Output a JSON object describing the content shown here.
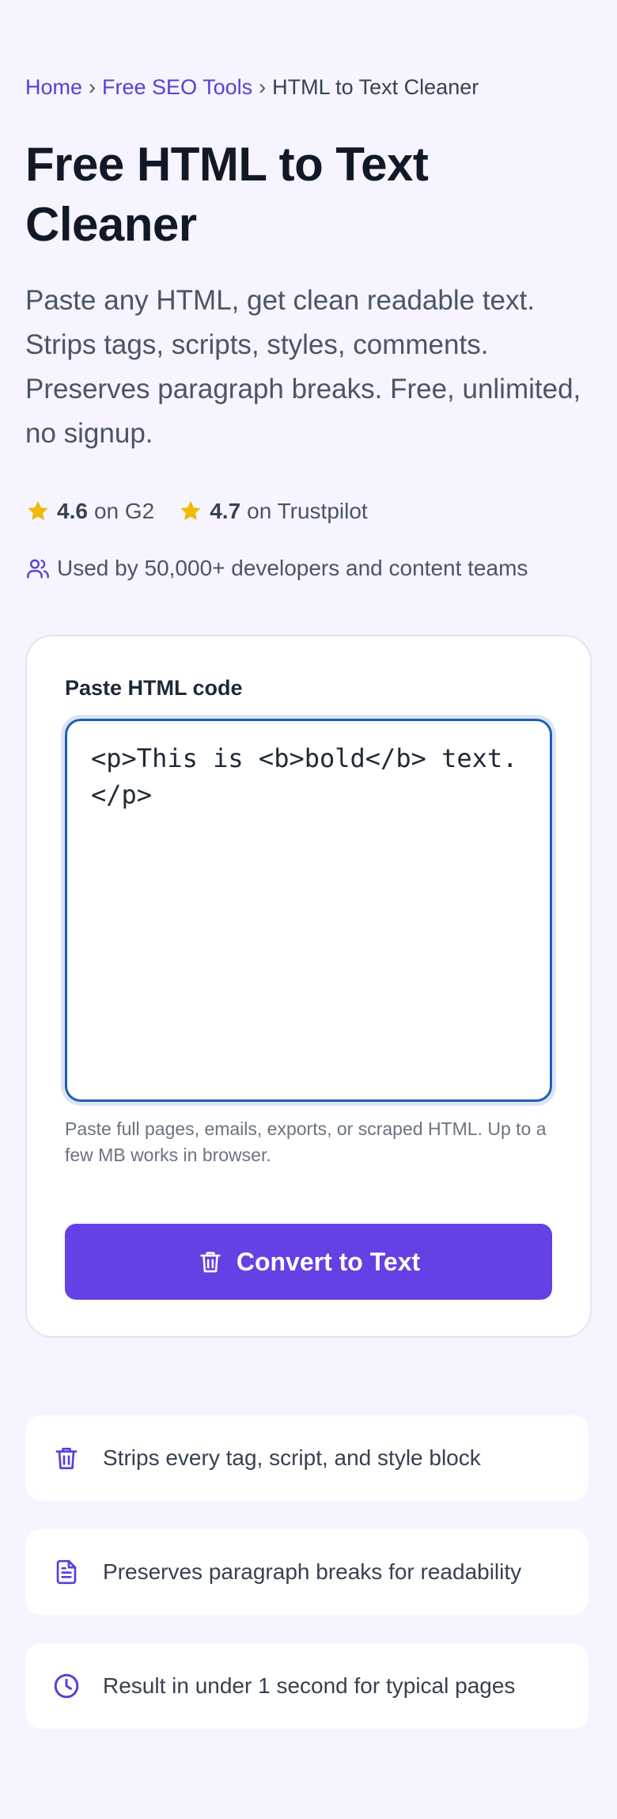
{
  "breadcrumb": {
    "items": [
      "Home",
      "Free SEO Tools"
    ],
    "separator": "›",
    "current": "HTML to Text Cleaner"
  },
  "title": "Free HTML to Text Cleaner",
  "subtitle": "Paste any HTML, get clean readable text. Strips tags, scripts, styles, comments. Preserves paragraph breaks. Free, unlimited, no signup.",
  "ratings": [
    {
      "icon": "star-icon",
      "score": "4.6",
      "source": "on G2"
    },
    {
      "icon": "star-icon",
      "score": "4.7",
      "source": "on Trustpilot"
    }
  ],
  "social_proof": {
    "icon": "users-icon",
    "text": "Used by 50,000+ developers and content teams"
  },
  "tool": {
    "label": "Paste HTML code",
    "input_value": "<p>This is <b>bold</b> text.</p>",
    "hint": "Paste full pages, emails, exports, or scraped HTML. Up to a few MB works in browser.",
    "button_label": "Convert to Text",
    "button_icon": "trash-icon"
  },
  "features": [
    {
      "icon": "trash-icon",
      "text": "Strips every tag, script, and style block"
    },
    {
      "icon": "document-icon",
      "text": "Preserves paragraph breaks for readability"
    },
    {
      "icon": "clock-icon",
      "text": "Result in under 1 second for typical pages"
    }
  ],
  "colors": {
    "accent": "#6440e5",
    "link": "#5b3fd6",
    "star": "#f0b90b",
    "page_background": "#f5f4ff",
    "input_border": "#1d5fb0"
  }
}
